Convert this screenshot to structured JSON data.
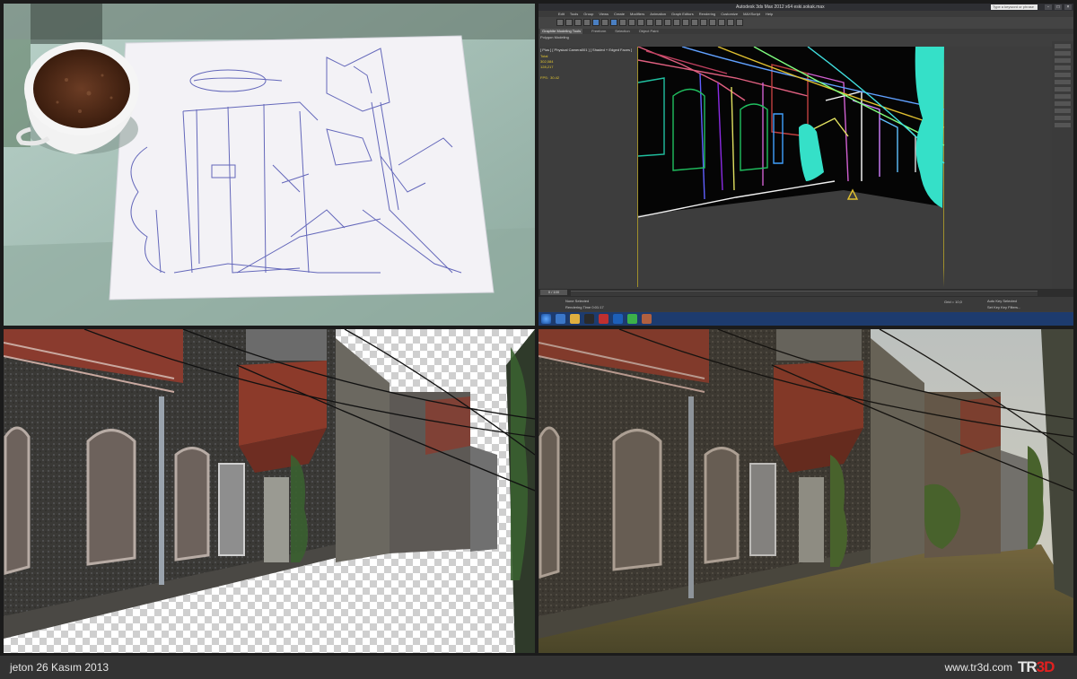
{
  "max": {
    "window_title": "Autodesk 3ds Max 2012 x64  eski.sokak.max",
    "search_placeholder": "Type a keyword or phrase",
    "menu": [
      "Edit",
      "Tools",
      "Group",
      "Views",
      "Create",
      "Modifiers",
      "Animation",
      "Graph Editors",
      "Rendering",
      "Customize",
      "MAXScript",
      "Help"
    ],
    "ribbon_tabs": [
      "Graphite Modeling Tools",
      "Freeform",
      "Selection",
      "Object Paint"
    ],
    "ribbon_active": "Graphite Modeling Tools",
    "sub_label": "Polygon Modeling",
    "viewport_label": "[ Plus ] [ Physical Camera001 ] [ Shaded + Edged Faces ]",
    "stats": "Total\n302,084\n128,217\n\nFPS:  30.42",
    "time_slider": "0 / 100",
    "status_selected": "None Selected",
    "status_time": "Rendering Time  0:01:17",
    "status_right": "Auto Key  Selected",
    "status_right2": "Set Key  Key Filters...",
    "status_grid": "Grid = 10,0"
  },
  "footer": {
    "caption": "jeton 26 Kasım 2013",
    "url": "www.tr3d.com",
    "logo_tr": "TR",
    "logo_3d": "3D"
  }
}
